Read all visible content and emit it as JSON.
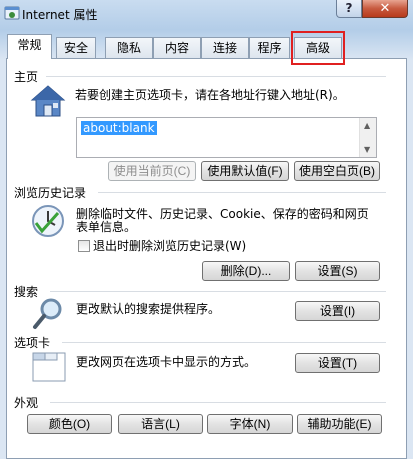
{
  "window": {
    "title": "Internet 属性",
    "help_label": "?",
    "close_label": "✕"
  },
  "tabs": [
    {
      "label": "常规",
      "active": true
    },
    {
      "label": "安全"
    },
    {
      "label": "隐私"
    },
    {
      "label": "内容"
    },
    {
      "label": "连接"
    },
    {
      "label": "程序"
    },
    {
      "label": "高级"
    }
  ],
  "home": {
    "title": "主页",
    "description": "若要创建主页选项卡，请在各地址行键入地址(R)。",
    "url": "about:blank",
    "btn_current": "使用当前页(C)",
    "btn_default": "使用默认值(F)",
    "btn_blank": "使用空白页(B)"
  },
  "history": {
    "title": "浏览历史记录",
    "description_line1": "删除临时文件、历史记录、Cookie、保存的密码和网页",
    "description_line2": "表单信息。",
    "checkbox_label": "退出时删除浏览历史记录(W)",
    "btn_delete": "删除(D)...",
    "btn_settings": "设置(S)"
  },
  "search": {
    "title": "搜索",
    "description": "更改默认的搜索提供程序。",
    "btn_settings": "设置(I)"
  },
  "tabs_section": {
    "title": "选项卡",
    "description": "更改网页在选项卡中显示的方式。",
    "btn_settings": "设置(T)"
  },
  "appearance": {
    "title": "外观",
    "btn_colors": "颜色(O)",
    "btn_languages": "语言(L)",
    "btn_fonts": "字体(N)",
    "btn_accessibility": "辅助功能(E)"
  }
}
